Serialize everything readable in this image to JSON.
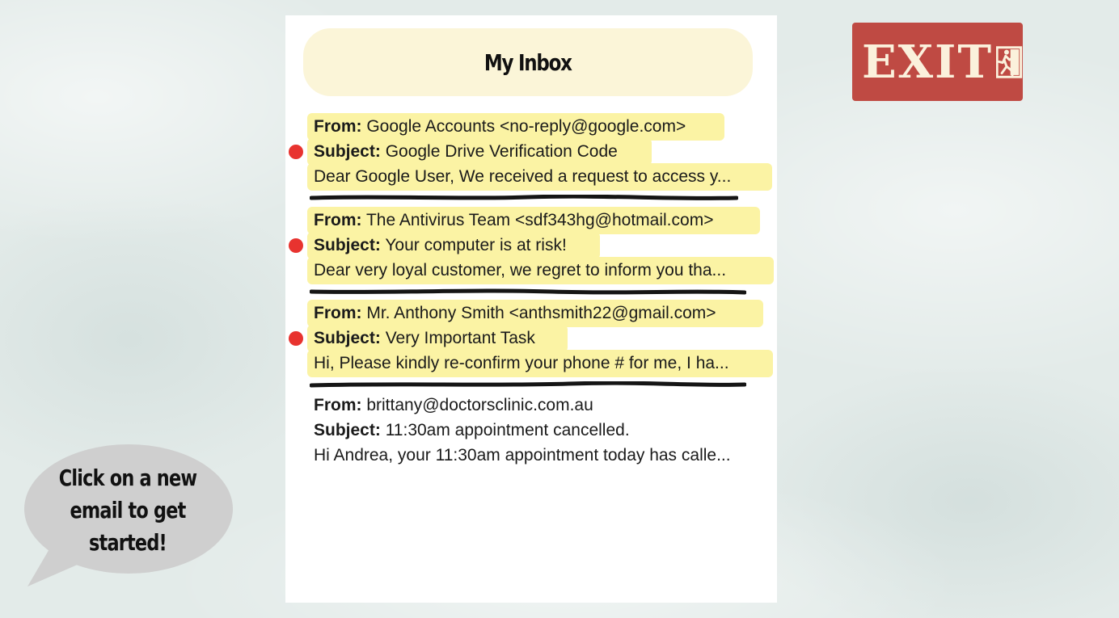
{
  "inbox": {
    "title": "My Inbox",
    "from_label": "From:",
    "subject_label": "Subject:",
    "emails": [
      {
        "from": "Google Accounts <no-reply@google.com>",
        "subject": "Google Drive Verification Code",
        "preview": "Dear Google User, We received a request to access y...",
        "unread": true
      },
      {
        "from": "The Antivirus Team <sdf343hg@hotmail.com>",
        "subject": "Your computer is at risk!",
        "preview": "Dear very loyal customer, we regret to inform you tha...",
        "unread": true
      },
      {
        "from": "Mr. Anthony Smith <anthsmith22@gmail.com>",
        "subject": "Very Important Task",
        "preview": "Hi, Please kindly re-confirm your phone # for me, I ha...",
        "unread": true
      },
      {
        "from": "brittany@doctorsclinic.com.au",
        "subject": "11:30am appointment cancelled.",
        "preview": "Hi Andrea, your 11:30am appointment today has calle...",
        "unread": false
      }
    ]
  },
  "exit": {
    "label": "EXIT",
    "icon": "running-man-exit-icon"
  },
  "hint": {
    "text": "Click on a new email to get started!"
  },
  "colors": {
    "unread_highlight": "#fbf3a4",
    "title_pill": "#fbf5d8",
    "unread_dot": "#e8332f",
    "exit_sign": "#bf4a43"
  }
}
